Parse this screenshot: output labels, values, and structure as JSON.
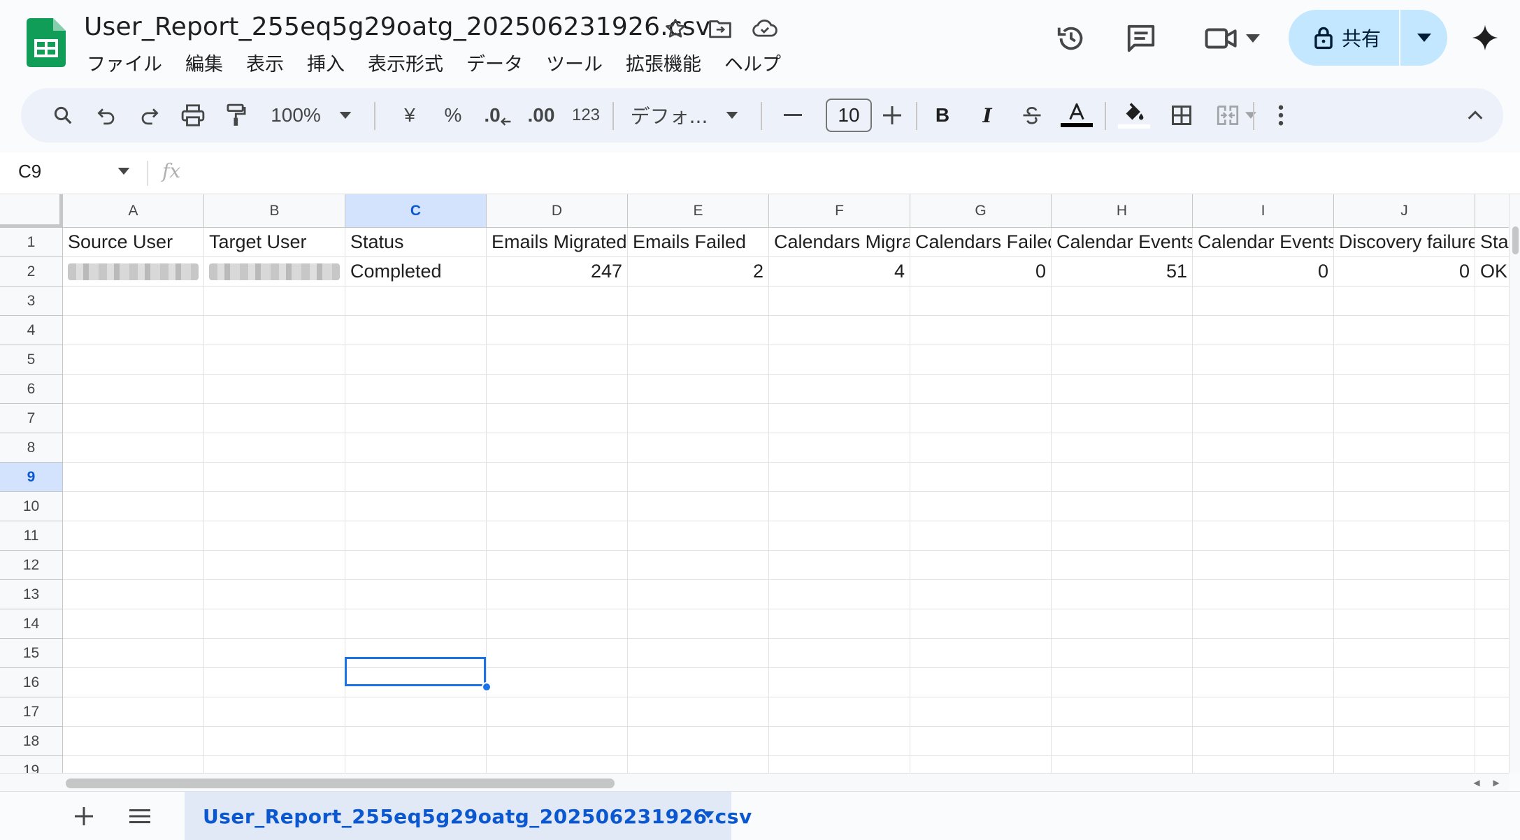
{
  "title_bar": {
    "file_name": "User_Report_255eq5g29oatg_202506231926.csv"
  },
  "menu": [
    "ファイル",
    "編集",
    "表示",
    "挿入",
    "表示形式",
    "データ",
    "ツール",
    "拡張機能",
    "ヘルプ"
  ],
  "share": {
    "label": "共有"
  },
  "toolbar": {
    "zoom": "100%",
    "currency": "¥",
    "percent": "%",
    "dec_decrease": ".0",
    "dec_increase": ".00",
    "number_format": "123",
    "font": "デフォ...",
    "font_size": "10",
    "bold": "B",
    "italic": "I"
  },
  "formula_bar": {
    "cell_ref": "C9",
    "fx": "fx",
    "formula": ""
  },
  "grid": {
    "columns": [
      "A",
      "B",
      "C",
      "D",
      "E",
      "F",
      "G",
      "H",
      "I",
      "J"
    ],
    "selected_column": "C",
    "selected_row": 9,
    "row_numbers": [
      "1",
      "2",
      "3",
      "4",
      "5",
      "6",
      "7",
      "8",
      "9",
      "10",
      "11",
      "12",
      "13",
      "14",
      "15",
      "16",
      "17",
      "18",
      "19"
    ],
    "header_row": [
      "Source User",
      "Target User",
      "Status",
      "Emails Migrated",
      "Emails Failed",
      "Calendars Migra",
      "Calendars Failec",
      "Calendar Events",
      "Calendar Events",
      "Discovery failure",
      "Sta"
    ],
    "data_row": [
      "",
      "",
      "Completed",
      "247",
      "2",
      "4",
      "0",
      "51",
      "0",
      "0",
      "OK"
    ]
  },
  "sheet_tabs": {
    "active": "User_Report_255eq5g29oatg_202506231926.csv"
  },
  "colors": {
    "accent": "#0b57d0",
    "selection": "#1a73e8",
    "share_bg": "#c2e7ff",
    "sheets_green": "#0f9d58"
  }
}
